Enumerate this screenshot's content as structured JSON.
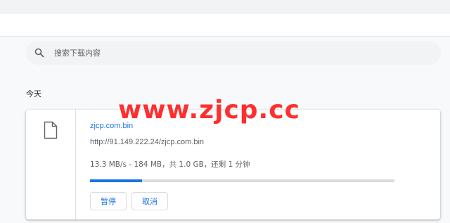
{
  "search": {
    "placeholder": "搜索下载内容",
    "icon": "search-icon"
  },
  "group": {
    "date_heading": "今天"
  },
  "download": {
    "file_name": "zjcp.com.bin",
    "url": "http://91.149.222.24/zjcp.com.bin",
    "status": "13.3 MB/s - 184 MB，共 1.0 GB，还剩 1 分钟",
    "progress": 0.17,
    "icon": "file-icon",
    "buttons": {
      "pause": "暂停",
      "cancel": "取消"
    }
  },
  "watermark": "www.zjcp.cc",
  "colors": {
    "accent": "#1a73e8",
    "watermark": "#ff2f2f",
    "track": "#dadce0",
    "background": "#f8f9fa"
  }
}
